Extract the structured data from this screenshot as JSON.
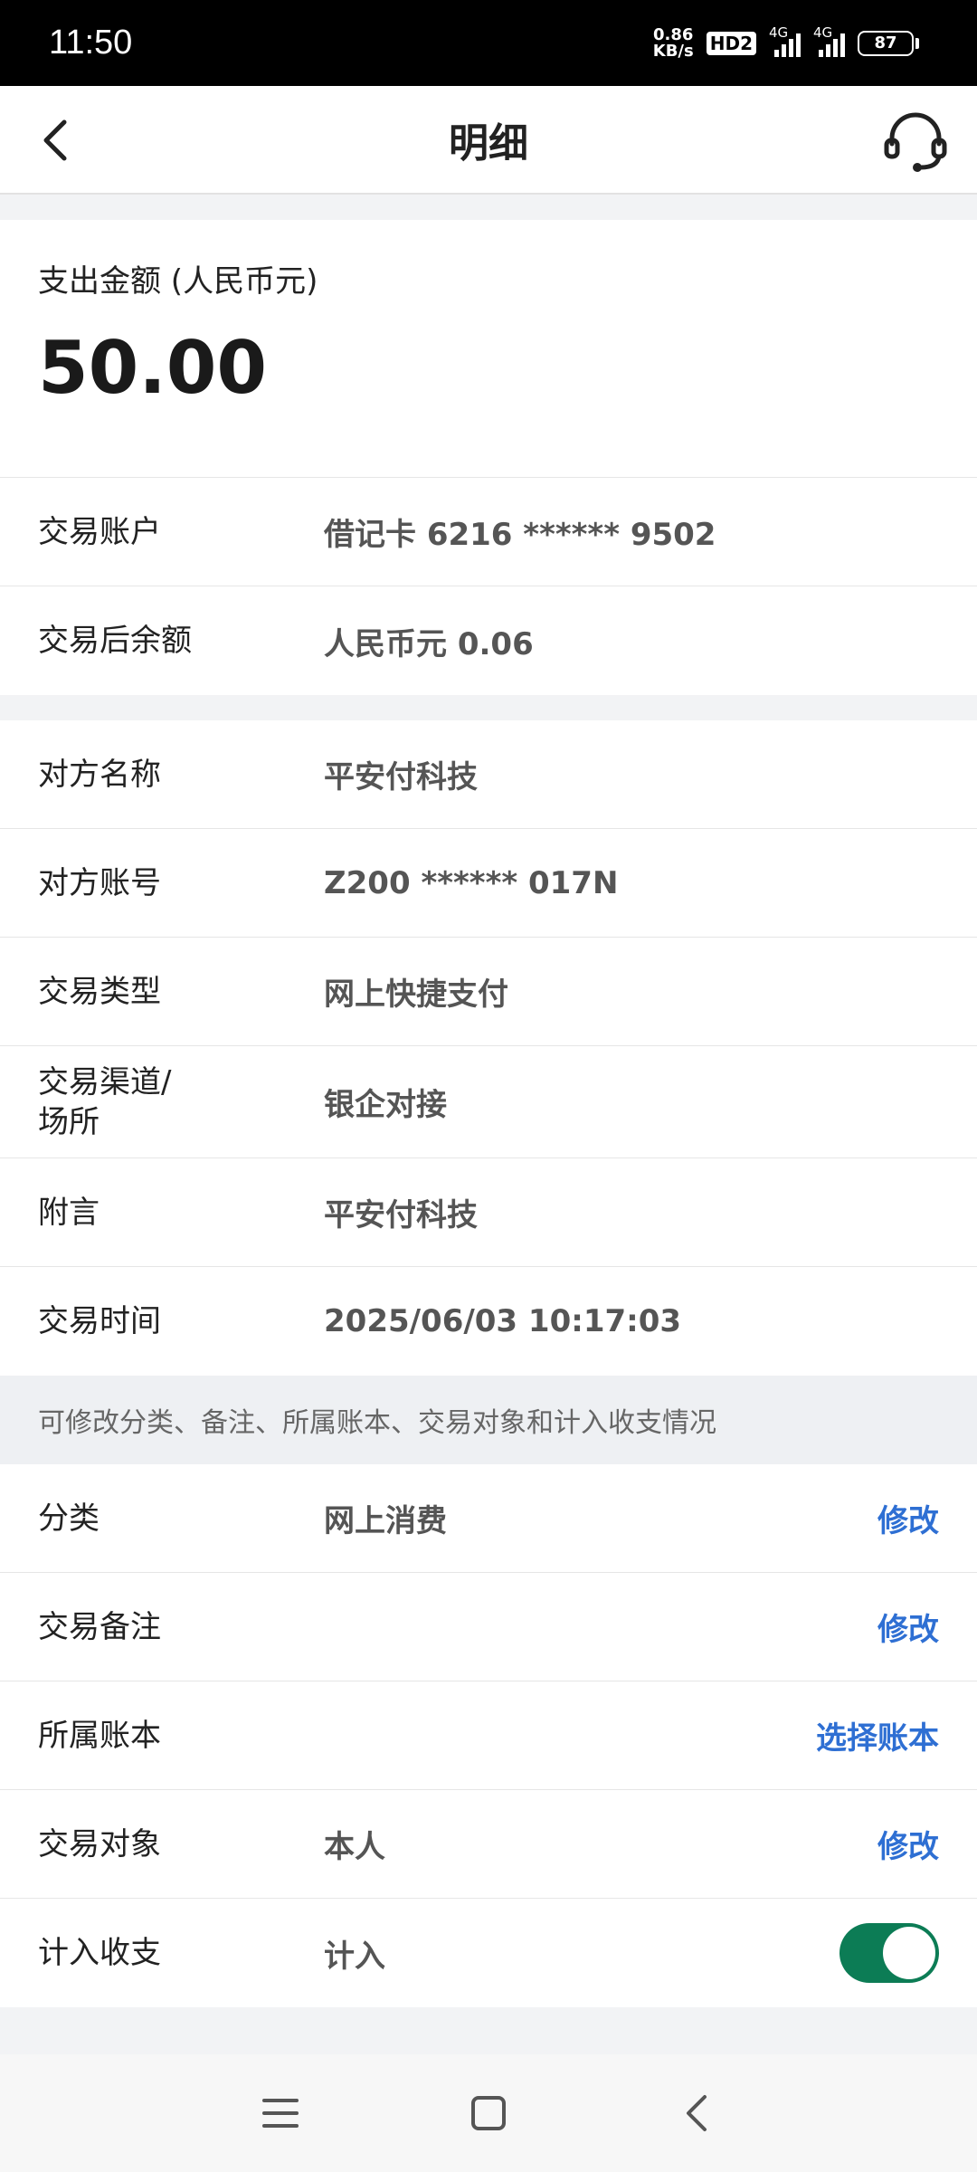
{
  "status_bar": {
    "time": "11:50",
    "net_speed_value": "0.86",
    "net_speed_unit": "KB/s",
    "hd_label": "HD2",
    "sim1_label": "4G",
    "sim2_label": "4G",
    "battery": "87"
  },
  "header": {
    "title": "明细",
    "back_icon": "chevron-left-icon",
    "support_icon": "headset-icon"
  },
  "amount": {
    "label": "支出金额 (人民币元)",
    "value": "50.00"
  },
  "account_section": [
    {
      "key": "交易账户",
      "value": "借记卡 6216 ****** 9502"
    },
    {
      "key": "交易后余额",
      "value": "人民币元 0.06"
    }
  ],
  "detail_section": [
    {
      "key": "对方名称",
      "value": "平安付科技"
    },
    {
      "key": "对方账号",
      "value": "Z200 ****** 017N"
    },
    {
      "key": "交易类型",
      "value": "网上快捷支付"
    },
    {
      "key_line1": "交易渠道/",
      "key_line2": "场所",
      "value": "银企对接"
    },
    {
      "key": "附言",
      "value": "平安付科技"
    },
    {
      "key": "交易时间",
      "value": "2025/06/03 10:17:03"
    }
  ],
  "notice": "可修改分类、备注、所属账本、交易对象和计入收支情况",
  "edit_section": {
    "category": {
      "key": "分类",
      "value": "网上消费",
      "action": "修改"
    },
    "remark": {
      "key": "交易备注",
      "value": "",
      "action": "修改"
    },
    "ledger": {
      "key": "所属账本",
      "value": "",
      "action": "选择账本"
    },
    "counterparty": {
      "key": "交易对象",
      "value": "本人",
      "action": "修改"
    },
    "include": {
      "key": "计入收支",
      "value": "计入",
      "toggle_on": true,
      "toggle_color": "#0c7c55"
    }
  },
  "colors": {
    "accent_link": "#2e6fd3",
    "toggle_on": "#0c7c55"
  },
  "nav_bar": {
    "menu_icon": "menu-icon",
    "home_icon": "square-home-icon",
    "back_icon": "triangle-back-icon"
  }
}
